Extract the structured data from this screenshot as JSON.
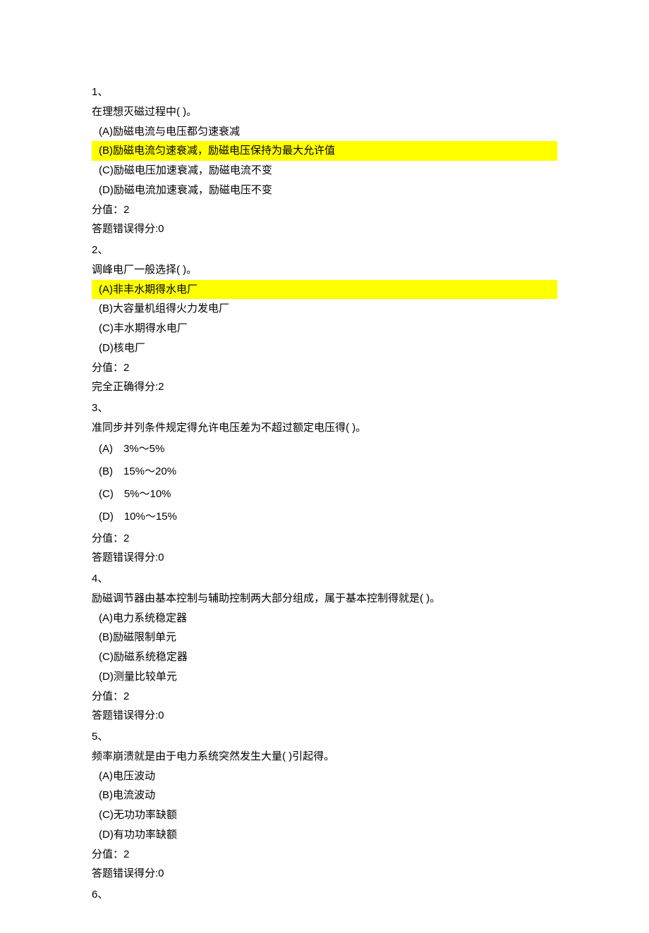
{
  "questions": [
    {
      "number": "1、",
      "stem": "在理想灭磁过程中( )。",
      "options": [
        {
          "text": "(A)励磁电流与电压都匀速衰减",
          "hl": false
        },
        {
          "text": "(B)励磁电流匀速衰减，励磁电压保持为最大允许值",
          "hl": true
        },
        {
          "text": "(C)励磁电压加速衰减，励磁电流不变",
          "hl": false
        },
        {
          "text": "(D)励磁电流加速衰减，励磁电压不变",
          "hl": false
        }
      ],
      "score_label": "分值：2",
      "result": "答题错误得分:0"
    },
    {
      "number": "2、",
      "stem": "调峰电厂一般选择( )。",
      "options": [
        {
          "text": "(A)非丰水期得水电厂",
          "hl": true
        },
        {
          "text": "(B)大容量机组得火力发电厂",
          "hl": false
        },
        {
          "text": "(C)丰水期得水电厂",
          "hl": false
        },
        {
          "text": "(D)核电厂",
          "hl": false
        }
      ],
      "score_label": "分值：2",
      "result": "完全正确得分:2"
    },
    {
      "number": "3、",
      "stem": "准同步并列条件规定得允许电压差为不超过额定电压得( )。",
      "wide": true,
      "options": [
        {
          "text": "(A)　3%～5%",
          "hl": false
        },
        {
          "text": "(B)　15%～20%",
          "hl": false
        },
        {
          "text": "(C)　5%～10%",
          "hl": false
        },
        {
          "text": "(D)　10%～15%",
          "hl": false
        }
      ],
      "score_label": "分值：2",
      "result": "答题错误得分:0"
    },
    {
      "number": "4、",
      "stem": "励磁调节器由基本控制与辅助控制两大部分组成，属于基本控制得就是( )。",
      "options": [
        {
          "text": "(A)电力系统稳定器",
          "hl": false
        },
        {
          "text": "(B)励磁限制单元",
          "hl": false
        },
        {
          "text": "(C)励磁系统稳定器",
          "hl": false
        },
        {
          "text": "(D)测量比较单元",
          "hl": false
        }
      ],
      "score_label": "分值：2",
      "result": "答题错误得分:0"
    },
    {
      "number": "5、",
      "stem": "频率崩溃就是由于电力系统突然发生大量( )引起得。",
      "options": [
        {
          "text": "(A)电压波动",
          "hl": false
        },
        {
          "text": "(B)电流波动",
          "hl": false
        },
        {
          "text": "(C)无功功率缺额",
          "hl": false
        },
        {
          "text": "(D)有功功率缺额",
          "hl": false
        }
      ],
      "score_label": "分值：2",
      "result": "答题错误得分:0"
    }
  ],
  "trailing_number": "6、"
}
